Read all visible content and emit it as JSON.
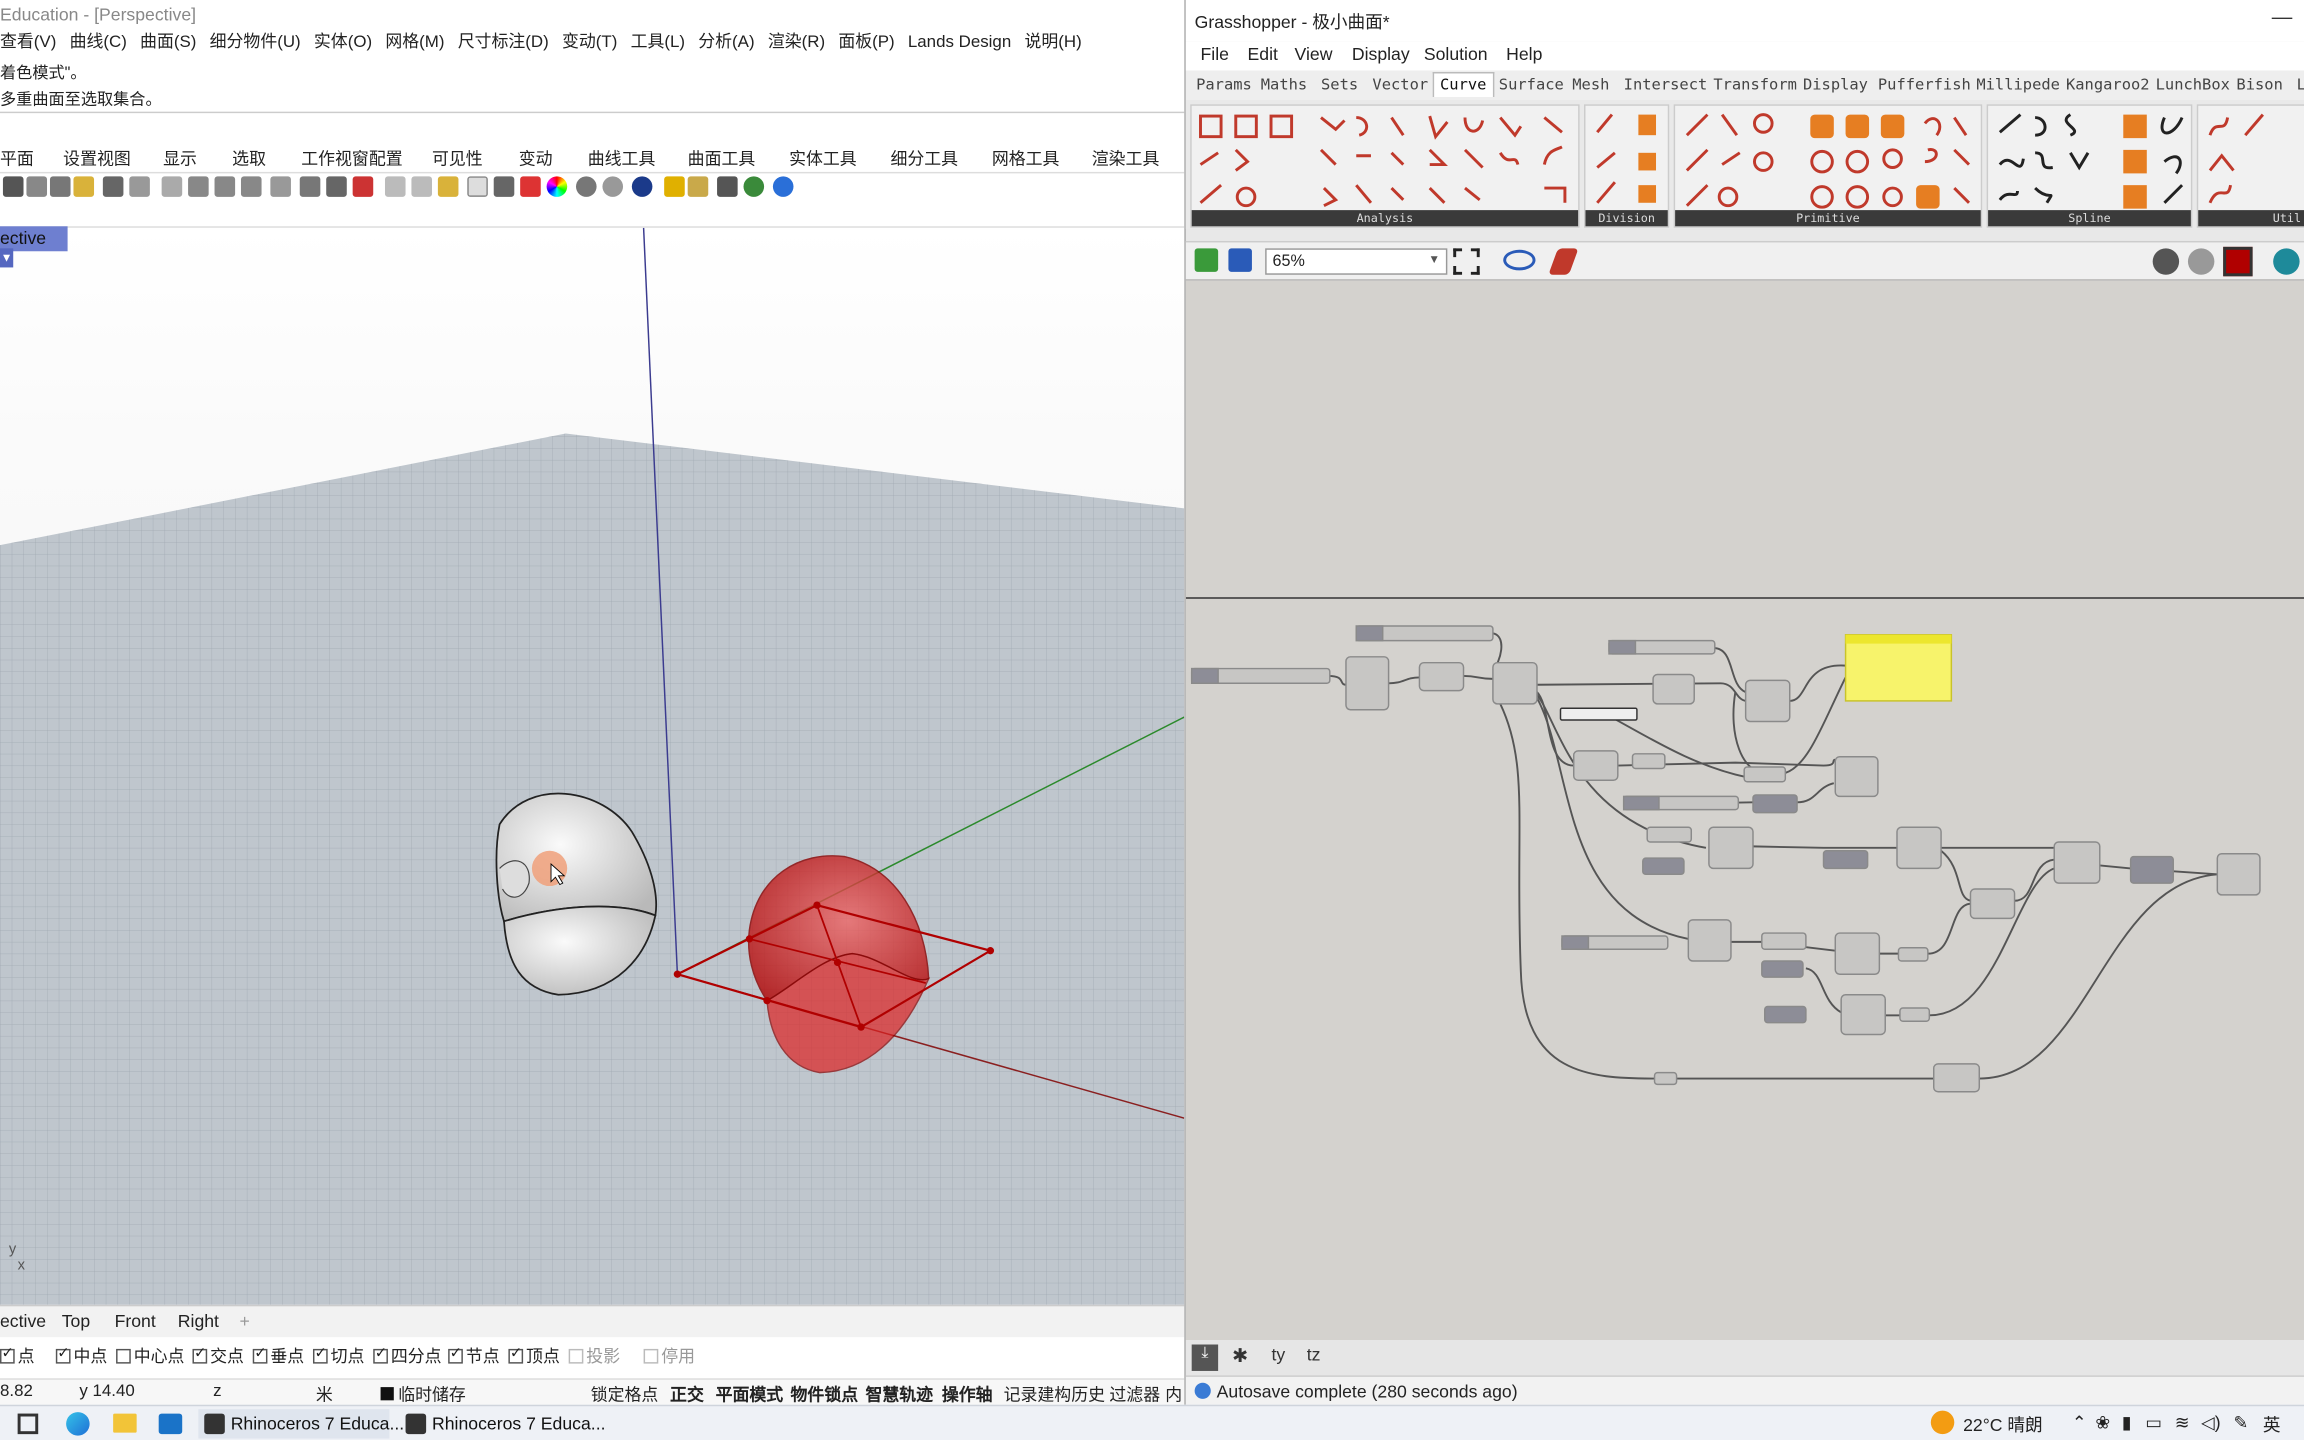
{
  "rhino": {
    "title": "Education - [Perspective]",
    "menu": [
      "查看(V)",
      "曲线(C)",
      "曲面(S)",
      "细分物件(U)",
      "实体(O)",
      "网格(M)",
      "尺寸标注(D)",
      "变动(T)",
      "工具(L)",
      "分析(A)",
      "渲染(R)",
      "面板(P)",
      "Lands Design",
      "说明(H)"
    ],
    "command_history": [
      "着色模式\"。",
      "多重曲面至选取集合。"
    ],
    "toolbar_tabs": [
      "平面",
      "设置视图",
      "显示",
      "选取",
      "工作视窗配置",
      "可见性",
      "变动",
      "曲线工具",
      "曲面工具",
      "实体工具",
      "细分工具",
      "网格工具",
      "渲染工具"
    ],
    "viewport_label": "ective",
    "axis_labels": [
      "y",
      "x"
    ],
    "view_tabs": [
      "ective",
      "Top",
      "Front",
      "Right",
      "+"
    ],
    "osnaps": [
      {
        "label": "点",
        "checked": true
      },
      {
        "label": "中点",
        "checked": true
      },
      {
        "label": "中心点",
        "checked": false
      },
      {
        "label": "交点",
        "checked": true
      },
      {
        "label": "垂点",
        "checked": true
      },
      {
        "label": "切点",
        "checked": true
      },
      {
        "label": "四分点",
        "checked": true
      },
      {
        "label": "节点",
        "checked": true
      },
      {
        "label": "顶点",
        "checked": true
      },
      {
        "label": "投影",
        "checked": false
      },
      {
        "label": "停用",
        "checked": false
      }
    ],
    "status": {
      "x": "8.82",
      "y": "y 14.40",
      "z": "z",
      "units": "米",
      "layer": "临时储存",
      "toggles": [
        "锁定格点",
        "正交",
        "平面模式",
        "物件锁点",
        "智慧轨迹",
        "操作轴",
        "记录建构历史",
        "过滤器",
        "内"
      ]
    }
  },
  "grasshopper": {
    "title": "Grasshopper - 极小曲面*",
    "menu": [
      "File",
      "Edit",
      "View",
      "Display",
      "Solution",
      "Help"
    ],
    "tabs": [
      "Params",
      "Maths",
      "Sets",
      "Vector",
      "Curve",
      "Surface",
      "Mesh",
      "Intersect",
      "Transform",
      "Display",
      "Pufferfish",
      "Millipede",
      "Kangaroo2",
      "LunchBox",
      "Bison",
      "L"
    ],
    "active_tab": "Curve",
    "panels": [
      "Analysis",
      "Division",
      "Primitive",
      "Spline",
      "Util"
    ],
    "zoom": "65%",
    "status": "Autosave complete (280 seconds ago)"
  },
  "taskbar": {
    "apps": [
      "Rhinoceros 7 Educa...",
      "Rhinoceros 7 Educa..."
    ],
    "weather": "22°C 晴朗",
    "ime": "英"
  },
  "colors": {
    "accent": "#6e7fd0",
    "red_surface": "#c00000",
    "gh_canvas": "#d4d2ce",
    "panel_yellow": "#f7f36b"
  }
}
